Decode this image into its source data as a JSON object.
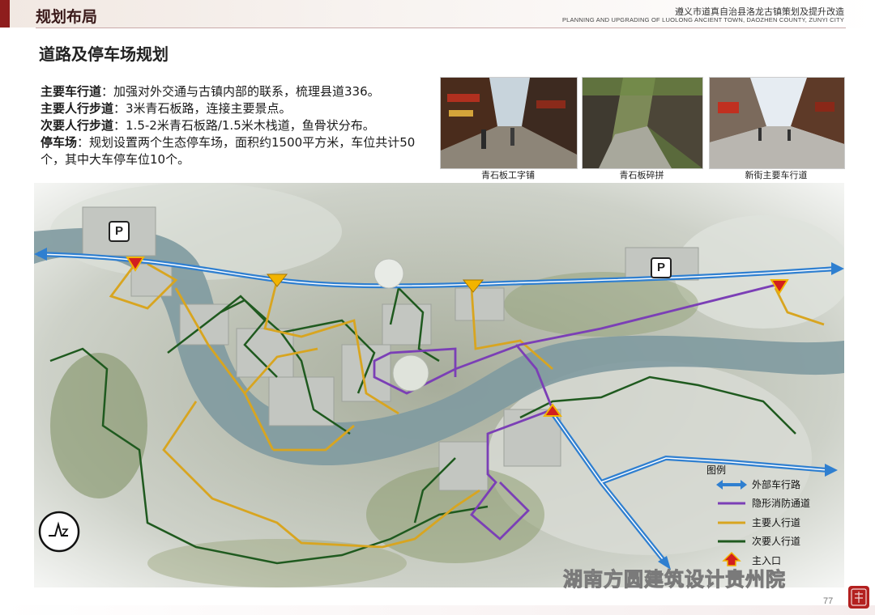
{
  "header": {
    "section": "规划布局",
    "project_cn": "遵义市道真自治县洛龙古镇策划及提升改造",
    "project_en": "PLANNING AND UPGRADING OF LUOLONG ANCIENT TOWN, DAOZHEN COUNTY, ZUNYI CITY"
  },
  "title": "道路及停车场规划",
  "description": [
    {
      "label": "主要车行道",
      "text": "：加强对外交通与古镇内部的联系，梳理县道336。"
    },
    {
      "label": "主要人行步道",
      "text": "：3米青石板路，连接主要景点。"
    },
    {
      "label": "次要人行步道",
      "text": "：1.5-2米青石板路/1.5米木栈道，鱼骨状分布。"
    },
    {
      "label": "停车场",
      "text": "：规划设置两个生态停车场，面积约1500平方米，车位共计50个，其中大车停车位10个。"
    }
  ],
  "photos": [
    {
      "caption": "青石板工字铺"
    },
    {
      "caption": "青石板碎拼"
    },
    {
      "caption": "新街主要车行道"
    }
  ],
  "map": {
    "parking_label": "P",
    "legend": {
      "title": "图例",
      "items": [
        {
          "label": "外部车行路",
          "color": "#2f7fd0",
          "symbol": "double-arrow"
        },
        {
          "label": "隐形消防通道",
          "color": "#7b3fb6",
          "symbol": "line"
        },
        {
          "label": "主要人行道",
          "color": "#d8a520",
          "symbol": "line"
        },
        {
          "label": "次要人行道",
          "color": "#1f5a1f",
          "symbol": "line"
        },
        {
          "label": "主入口",
          "color": "#d21f1f",
          "symbol": "arrow-up"
        }
      ]
    },
    "road_colors": {
      "external": "#2f7fd0",
      "fire": "#7b3fb6",
      "primary_walk": "#d8a520",
      "secondary_walk": "#1f5a1f",
      "entrance": "#d21f1f",
      "junction": "#f2b400"
    }
  },
  "footer": {
    "watermark": "湖南方圆建筑设计贵州院",
    "page": "77"
  }
}
